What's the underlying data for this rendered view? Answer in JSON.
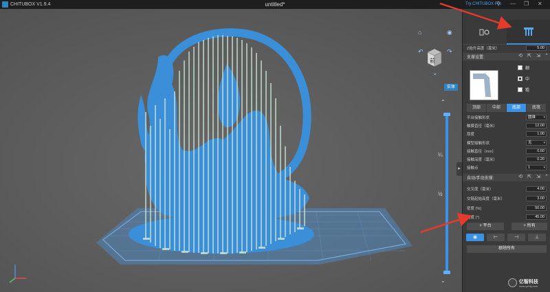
{
  "titlebar": {
    "app_name": "CHITUBOX V1.9.4",
    "document": "untitled*",
    "try_pro": "Try CHITUBOX Pro"
  },
  "viewport": {
    "nav_cube_label": "前",
    "entity_badge": "实体",
    "slider_quarter": "¼",
    "slider_half": "½",
    "icons": [
      "home-icon",
      "eye-icon",
      "undo-view-icon",
      "redo-view-icon",
      "nav-up-icon",
      "nav-down-icon"
    ],
    "axes_icon": "xyz-axes-icon"
  },
  "panel": {
    "tabs": [
      {
        "icon": "settings-icon"
      },
      {
        "icon": "support-columns-icon",
        "active": true
      }
    ],
    "z_lift_label": "Z抬升高度（毫米）",
    "z_lift_value": "5.00",
    "support_settings": "支撑设置:",
    "presets": [
      {
        "label": "细",
        "selected": false
      },
      {
        "label": "中",
        "selected": true
      },
      {
        "label": "粗",
        "selected": false
      }
    ],
    "segments": [
      "顶部",
      "中部",
      "底部",
      "底筏"
    ],
    "active_segment": "底部",
    "fields_a": [
      {
        "label": "平台接触形状",
        "value": "圆锥",
        "type": "select"
      },
      {
        "label": "触摸直径（毫米）",
        "value": "12.00",
        "type": "input"
      },
      {
        "label": "厚度",
        "value": "1.00",
        "type": "input"
      }
    ],
    "fields_b": [
      {
        "label": "模型接触形状",
        "value": "无",
        "type": "select"
      },
      {
        "label": "接触直径（mm）",
        "value": "0.60",
        "type": "input"
      },
      {
        "label": "接触深度（毫米）",
        "value": "0.20",
        "type": "input"
      },
      {
        "label": "接触点",
        "value": "1",
        "type": "select"
      }
    ],
    "auto_manual": "自动/手动支撑:",
    "fields_c": [
      {
        "label": "交叉度（毫米）",
        "value": "4.00"
      },
      {
        "label": "交链起始高度（毫米）",
        "value": "3.00"
      },
      {
        "label": "密度 (%)",
        "value": "50.00"
      },
      {
        "label": "角度 (°)",
        "value": "45.00"
      }
    ],
    "add_platform": "+ 平台",
    "add_all": "+ 所有",
    "remove_all": "移除所有"
  },
  "watermark": {
    "text": "亿智科技",
    "sub": "www.yzhkj.com"
  },
  "colors": {
    "accent": "#3a93e6",
    "model": "#3b8fd9",
    "support": "#c8e2d4",
    "annotation": "#e53b2c"
  }
}
